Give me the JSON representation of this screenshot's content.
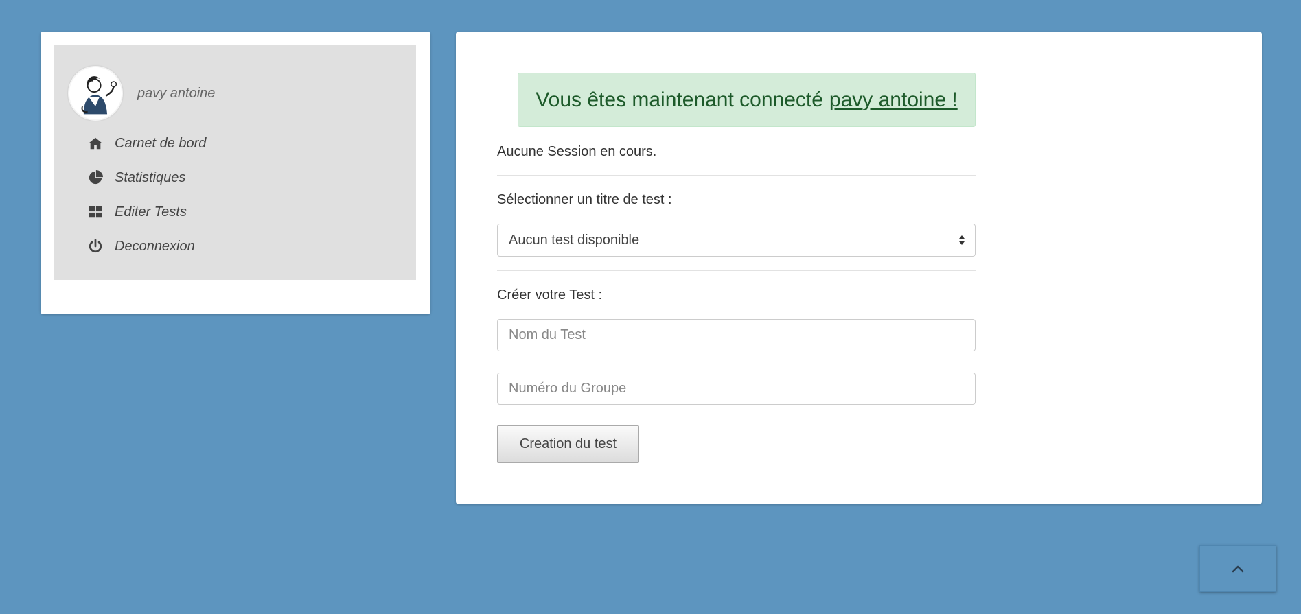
{
  "user": {
    "name": "pavy antoine"
  },
  "sidebar": {
    "items": [
      {
        "icon": "home-icon",
        "label": "Carnet de bord"
      },
      {
        "icon": "pie-chart-icon",
        "label": "Statistiques"
      },
      {
        "icon": "grid-icon",
        "label": "Editer Tests"
      },
      {
        "icon": "power-icon",
        "label": "Deconnexion"
      }
    ]
  },
  "alert": {
    "prefix": "Vous êtes maintenant connecté",
    "link": "pavy antoine !"
  },
  "session": {
    "status": "Aucune Session en cours."
  },
  "select_test": {
    "label": "Sélectionner un titre de test :",
    "value": "Aucun test disponible"
  },
  "create_test": {
    "label": "Créer votre Test :",
    "name_placeholder": "Nom du Test",
    "group_placeholder": "Numéro du Groupe",
    "button": "Creation du test"
  },
  "colors": {
    "background": "#5d95bf",
    "alert_bg": "#d4ecd9",
    "alert_text": "#1d5a2a",
    "sidebar_bg": "#e0e0e0"
  }
}
